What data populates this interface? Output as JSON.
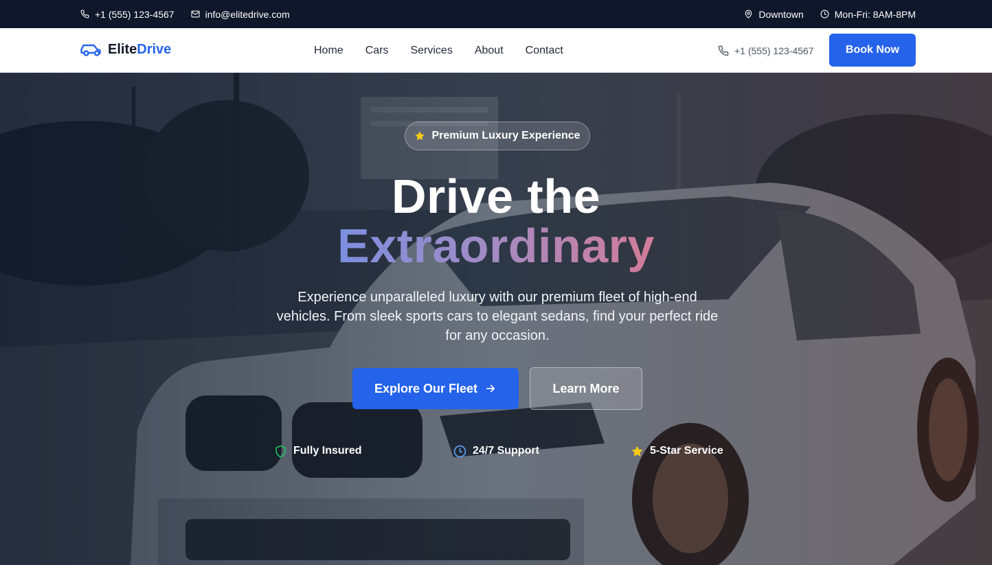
{
  "topbar": {
    "phone": "+1 (555) 123-4567",
    "email": "info@elitedrive.com",
    "location": "Downtown",
    "hours": "Mon-Fri: 8AM-8PM"
  },
  "nav": {
    "logo_part1": "Elite",
    "logo_part2": "Drive",
    "items": [
      "Home",
      "Cars",
      "Services",
      "About",
      "Contact"
    ],
    "phone": "+1 (555) 123-4567",
    "cta": "Book Now"
  },
  "hero": {
    "badge": "Premium Luxury Experience",
    "title_line1": "Drive the",
    "title_line2": "Extraordinary",
    "subtitle": "Experience unparalleled luxury with our premium fleet of high-end vehicles. From sleek sports cars to elegant sedans, find your perfect ride for any occasion.",
    "primary_button": "Explore Our Fleet",
    "secondary_button": "Learn More",
    "features": [
      "Fully Insured",
      "24/7 Support",
      "5-Star Service"
    ]
  },
  "colors": {
    "brand": "#2563eb",
    "topbar_bg": "#0f172a",
    "gradient_start": "#7b8fdf",
    "gradient_end": "#d27c97",
    "star": "#facc15",
    "shield": "#22c55e"
  },
  "icons": {
    "topbar": [
      "phone-icon",
      "mail-icon",
      "map-pin-icon",
      "clock-icon"
    ],
    "logo": "car-icon",
    "badge": "star-icon",
    "primary_button": "arrow-right-icon",
    "features": [
      "shield-icon",
      "clock-icon",
      "star-icon"
    ]
  }
}
